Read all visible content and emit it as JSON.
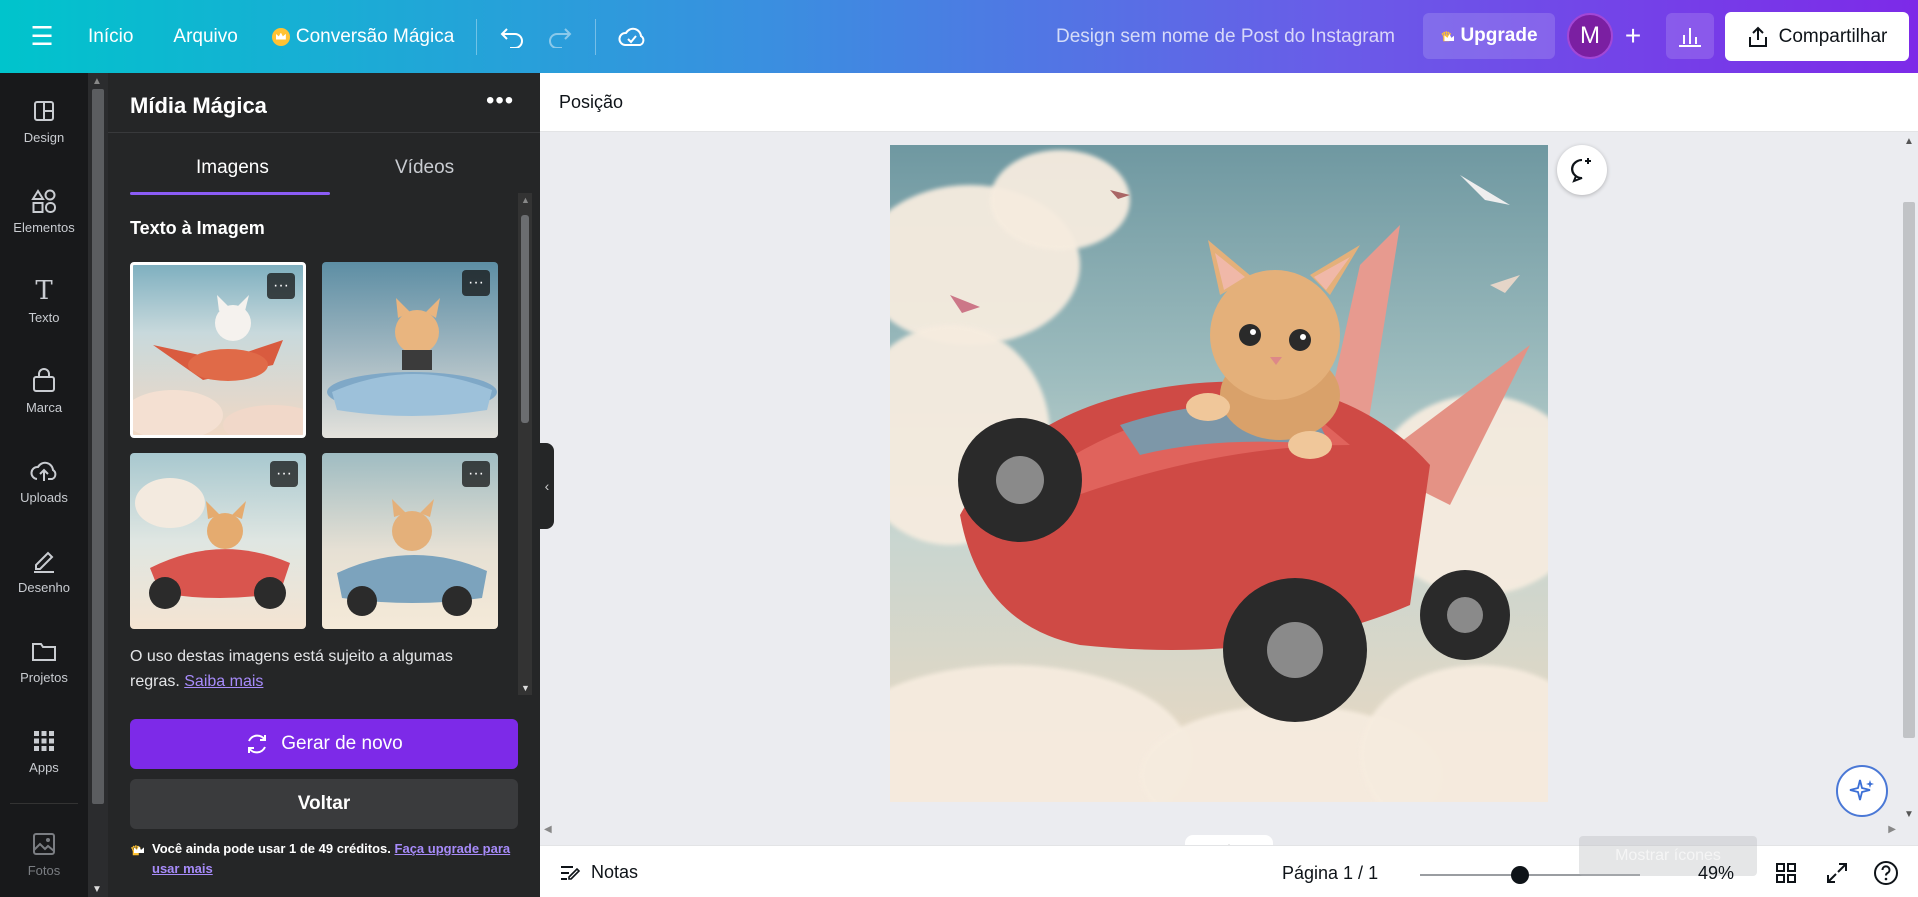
{
  "topbar": {
    "nav": [
      "Início",
      "Arquivo"
    ],
    "magic_label": "Conversão Mágica",
    "doc_title": "Design sem nome de Post do Instagram",
    "upgrade_label": "Upgrade",
    "avatar_letter": "M",
    "share_label": "Compartilhar"
  },
  "rail": {
    "items": [
      {
        "label": "Design",
        "icon": "layout-icon"
      },
      {
        "label": "Elementos",
        "icon": "shapes-icon"
      },
      {
        "label": "Texto",
        "icon": "text-icon"
      },
      {
        "label": "Marca",
        "icon": "brand-icon"
      },
      {
        "label": "Uploads",
        "icon": "cloud-upload-icon"
      },
      {
        "label": "Desenho",
        "icon": "draw-icon"
      },
      {
        "label": "Projetos",
        "icon": "folder-icon"
      },
      {
        "label": "Apps",
        "icon": "apps-grid-icon"
      },
      {
        "label": "Fotos",
        "icon": "photo-icon"
      }
    ]
  },
  "panel": {
    "title": "Mídia Mágica",
    "tabs": [
      "Imagens",
      "Vídeos"
    ],
    "section_title": "Texto à Imagem",
    "notice_text": "O uso destas imagens está sujeito a algumas regras.",
    "notice_link": "Saiba mais",
    "generate_label": "Gerar de novo",
    "back_label": "Voltar",
    "credits_text": "Você ainda pode usar 1 de 49 créditos.",
    "credits_link": "Faça upgrade para usar mais"
  },
  "canvas": {
    "context_label": "Posição"
  },
  "footer": {
    "notes_label": "Notas",
    "page_label": "Página 1 / 1",
    "zoom_label": "49%",
    "tooltip_label": "Mostrar ícones"
  },
  "colors": {
    "accent": "#7d2ae8",
    "link": "#a78bfa",
    "panel_bg": "#252627",
    "rail_bg": "#18191b"
  }
}
